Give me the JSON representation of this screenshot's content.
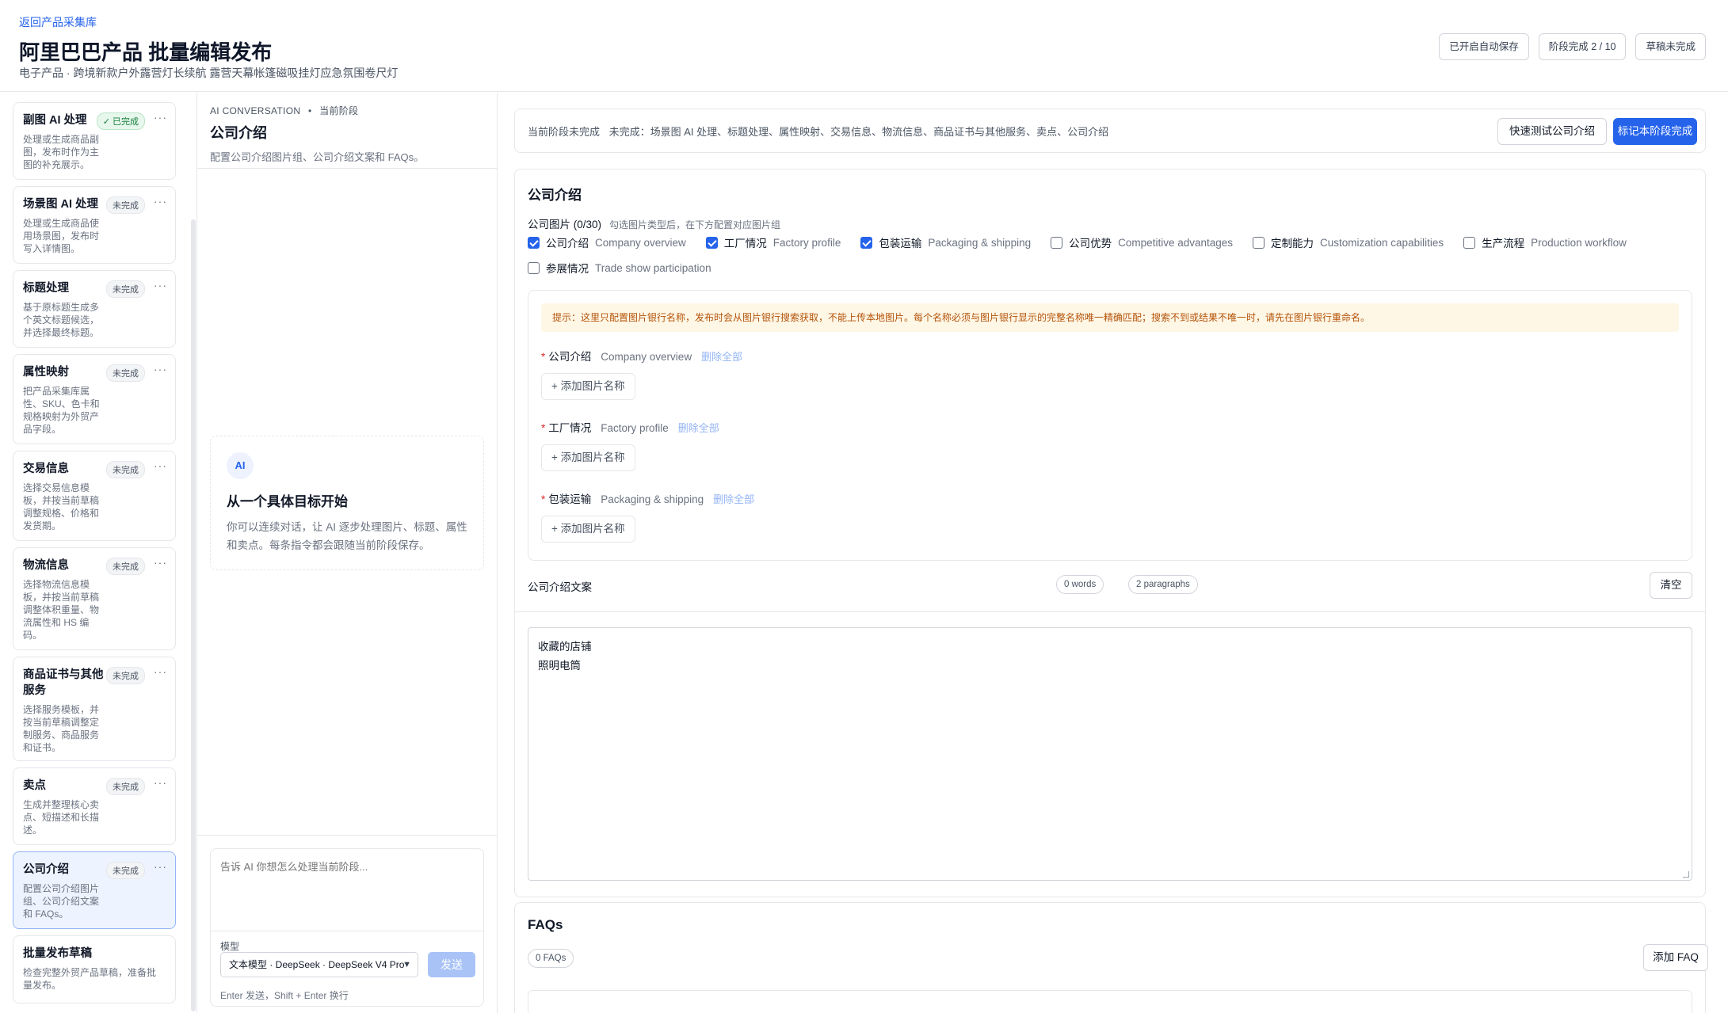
{
  "header": {
    "back_link": "返回产品采集库",
    "title": "阿里巴巴产品 批量编辑发布",
    "subtitle": "电子产品 · 跨境新款户外露营灯长续航 露营天幕帐篷磁吸挂灯应急氛围卷尺灯",
    "badges": [
      "已开启自动保存",
      "阶段完成 2 / 10",
      "草稿未完成"
    ]
  },
  "sidebar": {
    "stages": [
      {
        "title": "副图 AI 处理",
        "badge": "✓ 已完成",
        "done": true,
        "desc": "处理或生成商品副图，发布时作为主图的补充展示。"
      },
      {
        "title": "场景图 AI 处理",
        "badge": "未完成",
        "done": false,
        "desc": "处理或生成商品使用场景图，发布时写入详情图。"
      },
      {
        "title": "标题处理",
        "badge": "未完成",
        "done": false,
        "desc": "基于原标题生成多个英文标题候选，并选择最终标题。"
      },
      {
        "title": "属性映射",
        "badge": "未完成",
        "done": false,
        "desc": "把产品采集库属性、SKU、色卡和规格映射为外贸产品字段。"
      },
      {
        "title": "交易信息",
        "badge": "未完成",
        "done": false,
        "desc": "选择交易信息模板，并按当前草稿调整规格、价格和发货期。"
      },
      {
        "title": "物流信息",
        "badge": "未完成",
        "done": false,
        "desc": "选择物流信息模板，并按当前草稿调整体积重量、物流属性和 HS 编码。"
      },
      {
        "title": "商品证书与其他服务",
        "badge": "未完成",
        "done": false,
        "desc": "选择服务模板，并按当前草稿调整定制服务、商品服务和证书。"
      },
      {
        "title": "卖点",
        "badge": "未完成",
        "done": false,
        "desc": "生成并整理核心卖点、短描述和长描述。"
      },
      {
        "title": "公司介绍",
        "badge": "未完成",
        "done": false,
        "desc": "配置公司介绍图片组、公司介绍文案和 FAQs。"
      },
      {
        "title": "批量发布草稿",
        "badge": "",
        "done": false,
        "desc": "检查完整外贸产品草稿，准备批量发布。"
      }
    ],
    "more_glyph": "···"
  },
  "chat": {
    "kicker": "AI CONVERSATION",
    "kicker_sep": "•",
    "kicker_stage": "当前阶段",
    "title": "公司介绍",
    "desc": "配置公司介绍图片组、公司介绍文案和 FAQs。",
    "avatar": "AI",
    "empty_title": "从一个具体目标开始",
    "empty_text": "你可以连续对话，让 AI 逐步处理图片、标题、属性和卖点。每条指令都会跟随当前阶段保存。",
    "placeholder": "告诉 AI 你想怎么处理当前阶段...",
    "model_label": "模型",
    "model_value": "文本模型 · DeepSeek · DeepSeek V4 Pro",
    "send": "发送",
    "hint": "Enter 发送，Shift + Enter 换行"
  },
  "main": {
    "status_label": "当前阶段未完成",
    "status_detail": "未完成：场景图 AI 处理、标题处理、属性映射、交易信息、物流信息、商品证书与其他服务、卖点、公司介绍",
    "quick_test": "快速测试公司介绍",
    "mark_done": "标记本阶段完成",
    "company": {
      "title": "公司介绍",
      "images_label": "公司图片 (0/30)",
      "images_note": "勾选图片类型后，在下方配置对应图片组",
      "types": [
        {
          "cn": "公司介绍",
          "en": "Company overview",
          "checked": true
        },
        {
          "cn": "工厂情况",
          "en": "Factory profile",
          "checked": true
        },
        {
          "cn": "包装运输",
          "en": "Packaging & shipping",
          "checked": true
        },
        {
          "cn": "公司优势",
          "en": "Competitive advantages",
          "checked": false
        },
        {
          "cn": "定制能力",
          "en": "Customization capabilities",
          "checked": false
        },
        {
          "cn": "生产流程",
          "en": "Production workflow",
          "checked": false
        },
        {
          "cn": "参展情况",
          "en": "Trade show participation",
          "checked": false
        }
      ],
      "tip": "提示：这里只配置图片银行名称，发布时会从图片银行搜索获取，不能上传本地图片。每个名称必须与图片银行显示的完整名称唯一精确匹配；搜索不到或结果不唯一时，请先在图片银行重命名。",
      "groups": [
        {
          "cn": "公司介绍",
          "en": "Company overview"
        },
        {
          "cn": "工厂情况",
          "en": "Factory profile"
        },
        {
          "cn": "包装运输",
          "en": "Packaging & shipping"
        }
      ],
      "required_mark": "*",
      "delete_all": "删除全部",
      "add_name": "+ 添加图片名称",
      "copy_label": "公司介绍文案",
      "words": "0 words",
      "paragraphs": "2 paragraphs",
      "clear": "清空",
      "copy_lines": [
        "收藏的店铺",
        "照明电筒"
      ]
    },
    "faqs": {
      "title": "FAQs",
      "count": "0 FAQs",
      "add": "添加 FAQ"
    }
  }
}
